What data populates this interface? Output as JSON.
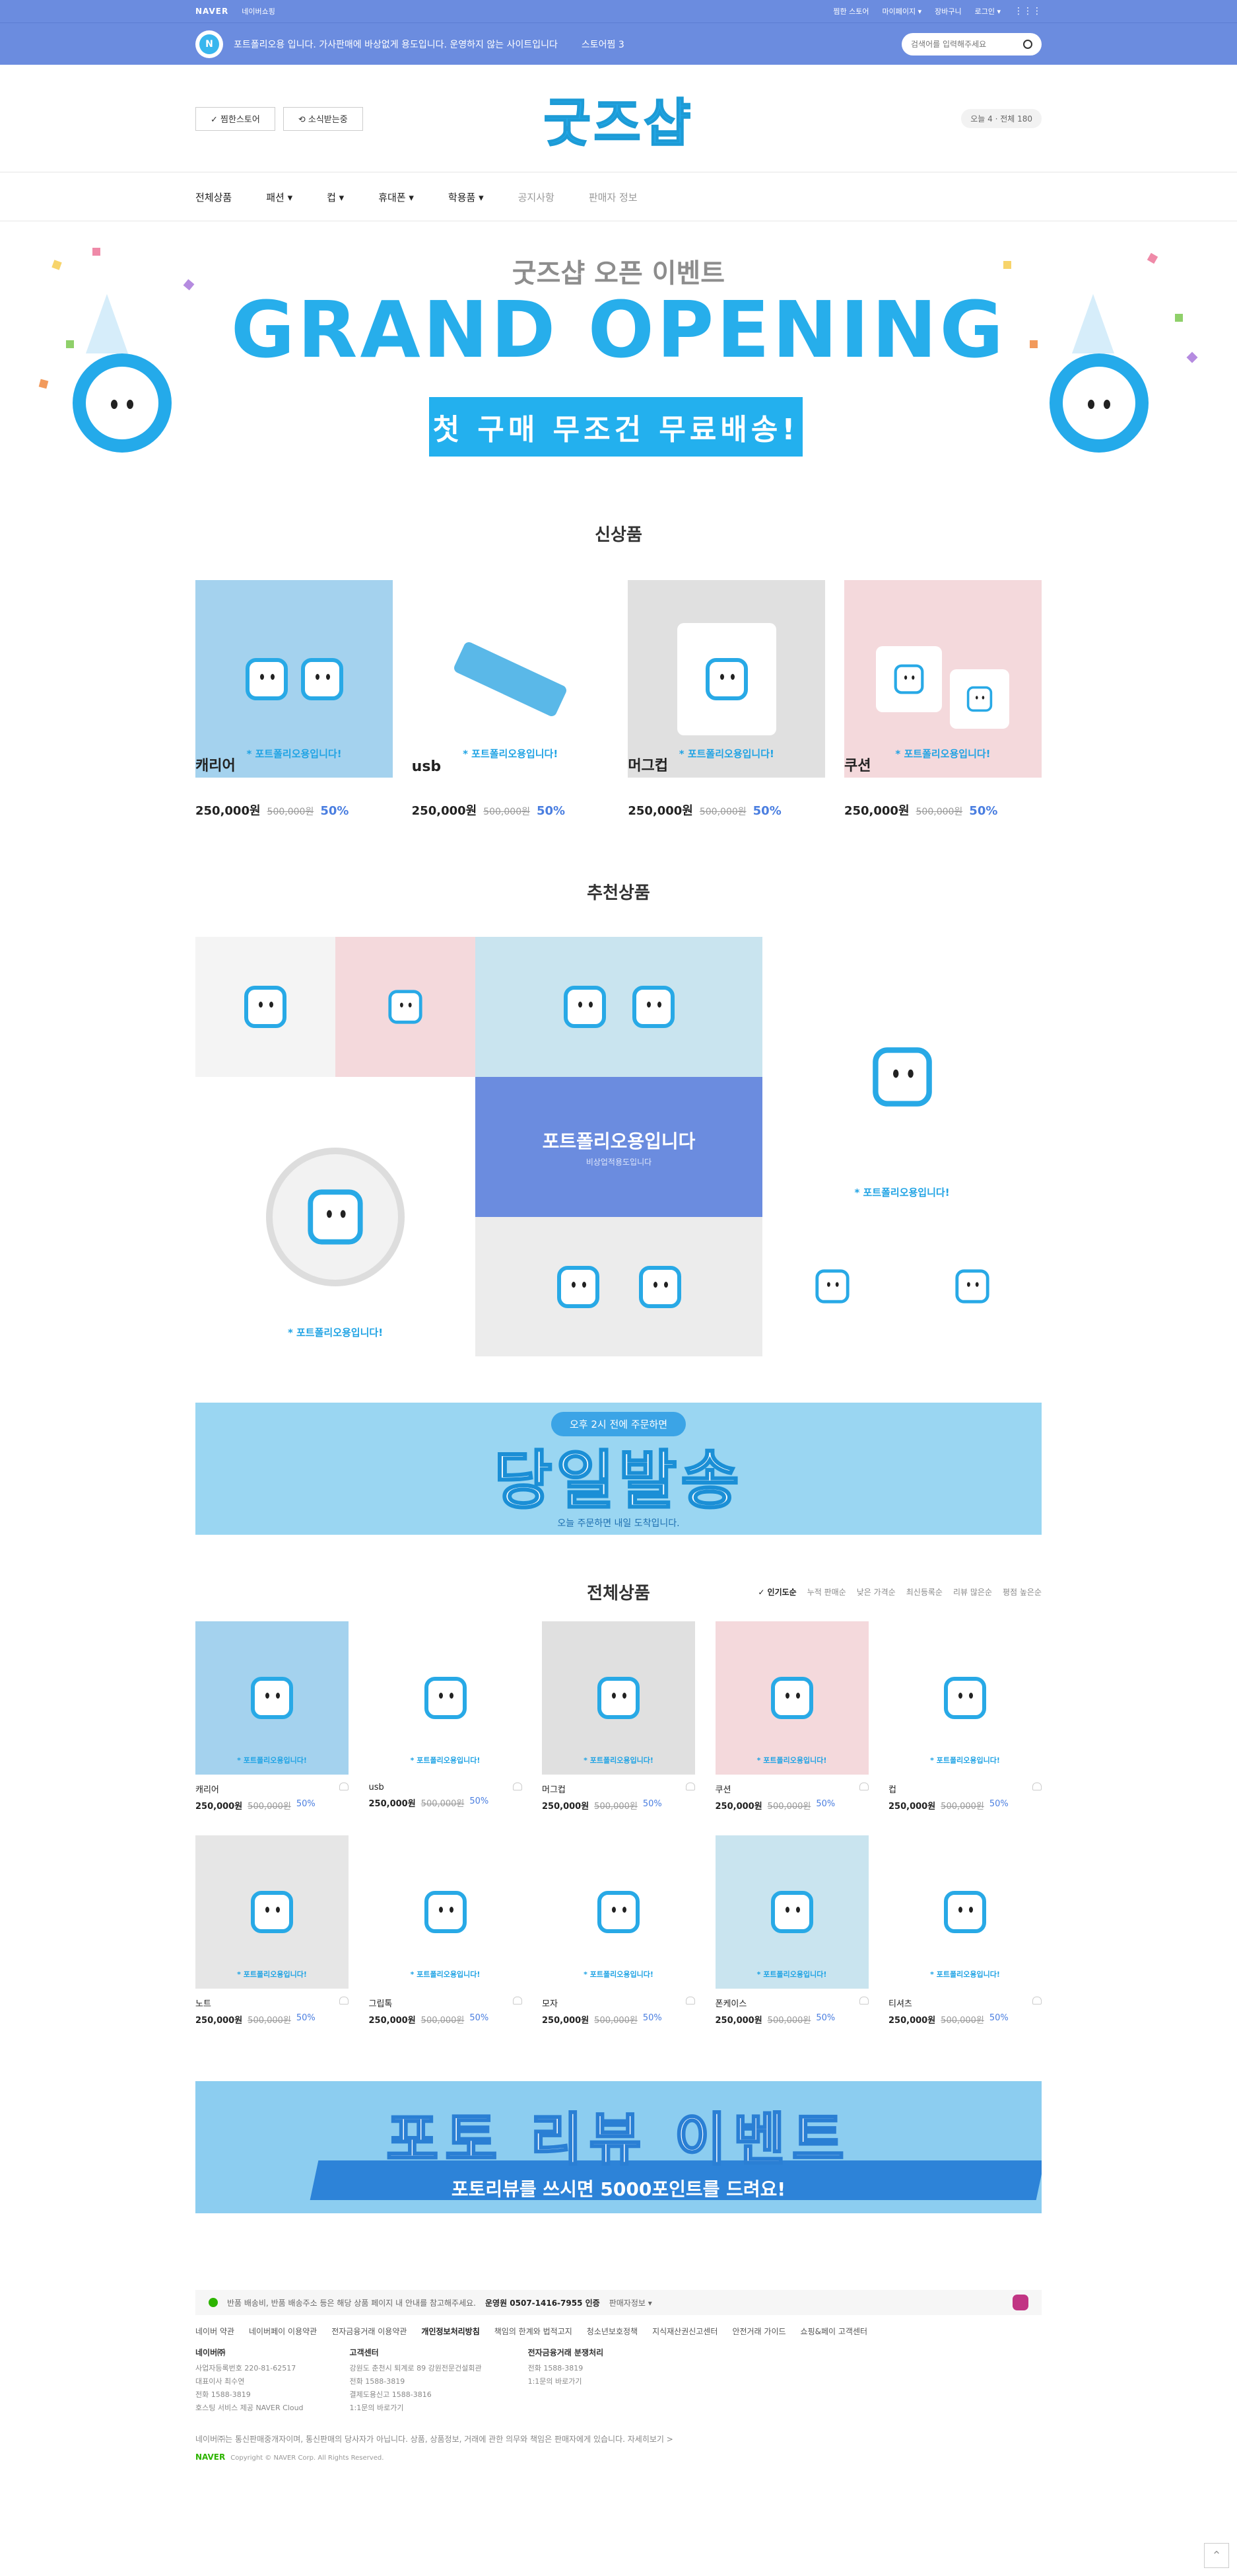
{
  "topbar": {
    "naver": "NAVER",
    "naver_shopping": "네이버쇼핑",
    "links": [
      "찜한 스토어",
      "마이페이지 ▾",
      "장바구니",
      "로그인 ▾"
    ]
  },
  "bluebar": {
    "badge": "N",
    "desc": "포트폴리오용 입니다. 가사판매에 바상없게 용도입니다. 운영하지 않는 사이트입니다",
    "store": "스토어찜 3",
    "search_placeholder": "검색어를 입력해주세요"
  },
  "header": {
    "btn1": "✓ 찜한스토어",
    "btn2": "⟲ 소식받는중",
    "logo": "굿즈샵",
    "visitors": "오늘 4 · 전체 180"
  },
  "gnb": [
    "전체상품",
    "패션 ▾",
    "컵 ▾",
    "휴대폰 ▾",
    "학용품 ▾",
    "공지사항",
    "판매자 정보"
  ],
  "hero": {
    "sub": "굿즈샵 오픈 이벤트",
    "title": "GRAND OPENING",
    "ribbon": "첫 구매 무조건 무료배송!"
  },
  "new_products": {
    "title": "신상품",
    "items": [
      {
        "name": "캐리어",
        "price": "250,000원",
        "old": "500,000원",
        "rate": "50%",
        "tag": "* 포트폴리오용입니다!"
      },
      {
        "name": "usb",
        "price": "250,000원",
        "old": "500,000원",
        "rate": "50%",
        "tag": "* 포트폴리오용입니다!"
      },
      {
        "name": "머그컵",
        "price": "250,000원",
        "old": "500,000원",
        "rate": "50%",
        "tag": "* 포트폴리오용입니다!"
      },
      {
        "name": "쿠션",
        "price": "250,000원",
        "old": "500,000원",
        "rate": "50%",
        "tag": "* 포트폴리오용입니다!"
      }
    ]
  },
  "recommended": {
    "title": "추천상품",
    "center_title": "포트폴리오용입니다",
    "center_sub": "비상업적용도입니다",
    "tag": "* 포트폴리오용입니다!"
  },
  "banner1": {
    "pill": "오후 2시 전에 주문하면",
    "big": "당일발송",
    "small": "오늘 주문하면 내일 도착입니다."
  },
  "all_products": {
    "title": "전체상품",
    "sort": [
      "✓ 인기도순",
      "누적 판매순",
      "낮은 가격순",
      "최신등록순",
      "리뷰 많은순",
      "평점 높은순"
    ],
    "items": [
      {
        "name": "캐리어",
        "price": "250,000원",
        "old": "500,000원",
        "rate": "50%"
      },
      {
        "name": "usb",
        "price": "250,000원",
        "old": "500,000원",
        "rate": "50%"
      },
      {
        "name": "머그컵",
        "price": "250,000원",
        "old": "500,000원",
        "rate": "50%"
      },
      {
        "name": "쿠션",
        "price": "250,000원",
        "old": "500,000원",
        "rate": "50%"
      },
      {
        "name": "컵",
        "price": "250,000원",
        "old": "500,000원",
        "rate": "50%"
      },
      {
        "name": "노트",
        "price": "250,000원",
        "old": "500,000원",
        "rate": "50%"
      },
      {
        "name": "그립톡",
        "price": "250,000원",
        "old": "500,000원",
        "rate": "50%"
      },
      {
        "name": "모자",
        "price": "250,000원",
        "old": "500,000원",
        "rate": "50%"
      },
      {
        "name": "폰케이스",
        "price": "250,000원",
        "old": "500,000원",
        "rate": "50%"
      },
      {
        "name": "티셔츠",
        "price": "250,000원",
        "old": "500,000원",
        "rate": "50%"
      }
    ],
    "tag": "* 포트폴리오용입니다!"
  },
  "banner2": {
    "big": "포토 리뷰 이벤트",
    "small": "포토리뷰를 쓰시면 5000포인트를 드려요!"
  },
  "footer": {
    "notice": "반품 배송비, 반품 배송주소 등은 해당 상품 페이지 내 안내를 참고해주세요.",
    "tel": "운영원 0507-1416-7955 인증",
    "seller": "판매자정보 ▾",
    "links": [
      "네이버 약관",
      "네이버페이 이용약관",
      "전자금융거래 이용약관",
      "개인정보처리방침",
      "책임의 한계와 법적고지",
      "청소년보호정책",
      "지식재산권신고센터",
      "안전거래 가이드",
      "쇼핑&페이 고객센터"
    ],
    "col1": {
      "title": "네이버㈜",
      "lines": [
        "사업자등록번호 220-81-62517",
        "대표이사 최수연",
        "전화 1588-3819",
        "호스팅 서비스 제공 NAVER Cloud"
      ]
    },
    "col2": {
      "title": "고객센터",
      "lines": [
        "강원도 춘천시 퇴계로 89 강원전문건설회관",
        "전화 1588-3819",
        "결제도용신고 1588-3816",
        "1:1문의 바로가기"
      ]
    },
    "col3": {
      "title": "전자금융거래 분쟁처리",
      "lines": [
        "전화 1588-3819",
        "1:1문의 바로가기"
      ]
    },
    "note": "네이버㈜는 통신판매중개자이며, 통신판매의 당사자가 아닙니다. 상품, 상품정보, 거래에 관한 의무와 책임은 판매자에게 있습니다. 자세히보기 >",
    "logo": "NAVER",
    "copy": "Copyright © NAVER Corp. All Rights Reserved."
  },
  "colors": {
    "accent": "#6b8cdf",
    "brand_blue": "#27aeeb",
    "rate": "#4a7ee0"
  }
}
